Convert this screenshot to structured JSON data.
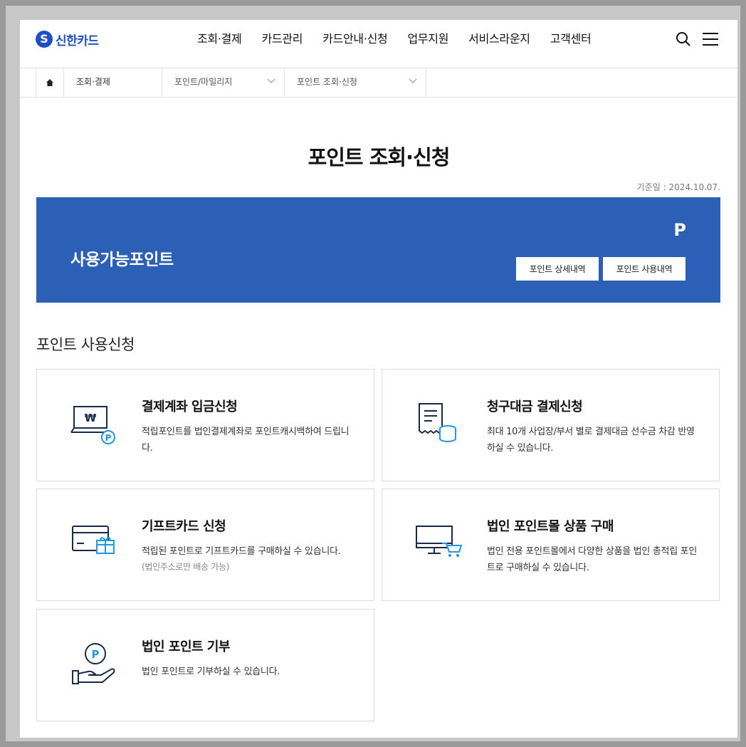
{
  "brand": {
    "logo_letter": "S",
    "name": "신한카드"
  },
  "nav": {
    "items": [
      "조회·결제",
      "카드관리",
      "카드안내·신청",
      "업무지원",
      "서비스라운지",
      "고객센터"
    ]
  },
  "breadcrumb": {
    "level1": "조회·결제",
    "level2": "포인트/마일리지",
    "level3": "포인트 조회·신청"
  },
  "page": {
    "title": "포인트 조회·신청",
    "date_line": "기준일 : 2024.10.07."
  },
  "banner": {
    "label": "사용가능포인트",
    "points": "P",
    "btn_detail": "포인트 상세내역",
    "btn_usage": "포인트 사용내역",
    "color": "#2c5fb6"
  },
  "section": {
    "title": "포인트 사용신청"
  },
  "cards": [
    {
      "title": "결제계좌 입금신청",
      "desc": "적립포인트를 법인결제계좌로 포인트캐시백하여 드립니다.",
      "note": "",
      "icon": "laptop-won-point-icon"
    },
    {
      "title": "청구대금 결제신청",
      "desc": "최대 10개 사업장/부서 별로 결제대금 선수금 차감 반영 하실 수 있습니다.",
      "note": "",
      "icon": "receipt-coins-icon"
    },
    {
      "title": "기프트카드 신청",
      "desc": "적립된 포인트로 기프트카드를 구매하실 수 있습니다.",
      "note": "(법인주소로만 배송 가능)",
      "icon": "card-gift-icon"
    },
    {
      "title": "법인 포인트몰 상품 구매",
      "desc": "법인 전용 포인트몰에서 다양한 상품을 법인 총적립 포인트로 구매하실 수 있습니다.",
      "note": "",
      "icon": "monitor-cart-icon"
    },
    {
      "title": "법인 포인트 기부",
      "desc": "법인 포인트로 기부하실 수 있습니다.",
      "note": "",
      "icon": "hand-point-icon"
    }
  ],
  "colors": {
    "accent": "#1f4fc4",
    "icon_navy": "#1a2a4a",
    "icon_blue": "#1e9be0"
  }
}
